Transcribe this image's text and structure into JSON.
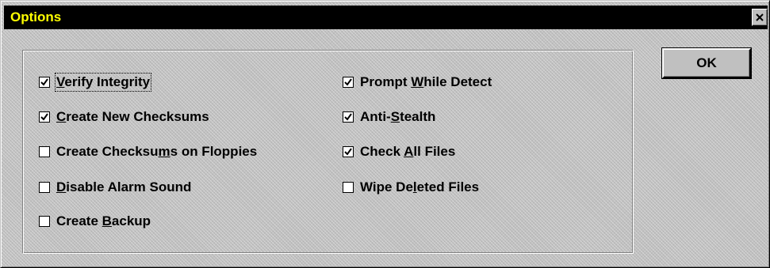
{
  "window": {
    "title": "Options",
    "title_color": "#ffff00",
    "titlebar_color": "#000000",
    "face_color": "#c0c0c0"
  },
  "close_button": {
    "icon": "close-icon"
  },
  "ok_button": {
    "label": "OK"
  },
  "options": {
    "left": [
      {
        "id": "verify-integrity",
        "before": "",
        "accel": "V",
        "after": "erify Integrity",
        "checked": true,
        "focused": true
      },
      {
        "id": "create-new-checksums",
        "before": "",
        "accel": "C",
        "after": "reate New Checksums",
        "checked": true
      },
      {
        "id": "create-checksums-on-floppies",
        "before": "Create Checksu",
        "accel": "m",
        "after": "s on Floppies",
        "checked": false
      },
      {
        "id": "disable-alarm-sound",
        "before": "",
        "accel": "D",
        "after": "isable Alarm Sound",
        "checked": false
      },
      {
        "id": "create-backup",
        "before": "Create ",
        "accel": "B",
        "after": "ackup",
        "checked": false
      }
    ],
    "right": [
      {
        "id": "prompt-while-detect",
        "before": "Prompt ",
        "accel": "W",
        "after": "hile Detect",
        "checked": true
      },
      {
        "id": "anti-stealth",
        "before": "Anti-",
        "accel": "S",
        "after": "tealth",
        "checked": true
      },
      {
        "id": "check-all-files",
        "before": "Check ",
        "accel": "A",
        "after": "ll Files",
        "checked": true
      },
      {
        "id": "wipe-deleted-files",
        "before": "Wipe De",
        "accel": "l",
        "after": "eted Files",
        "checked": false
      }
    ]
  }
}
